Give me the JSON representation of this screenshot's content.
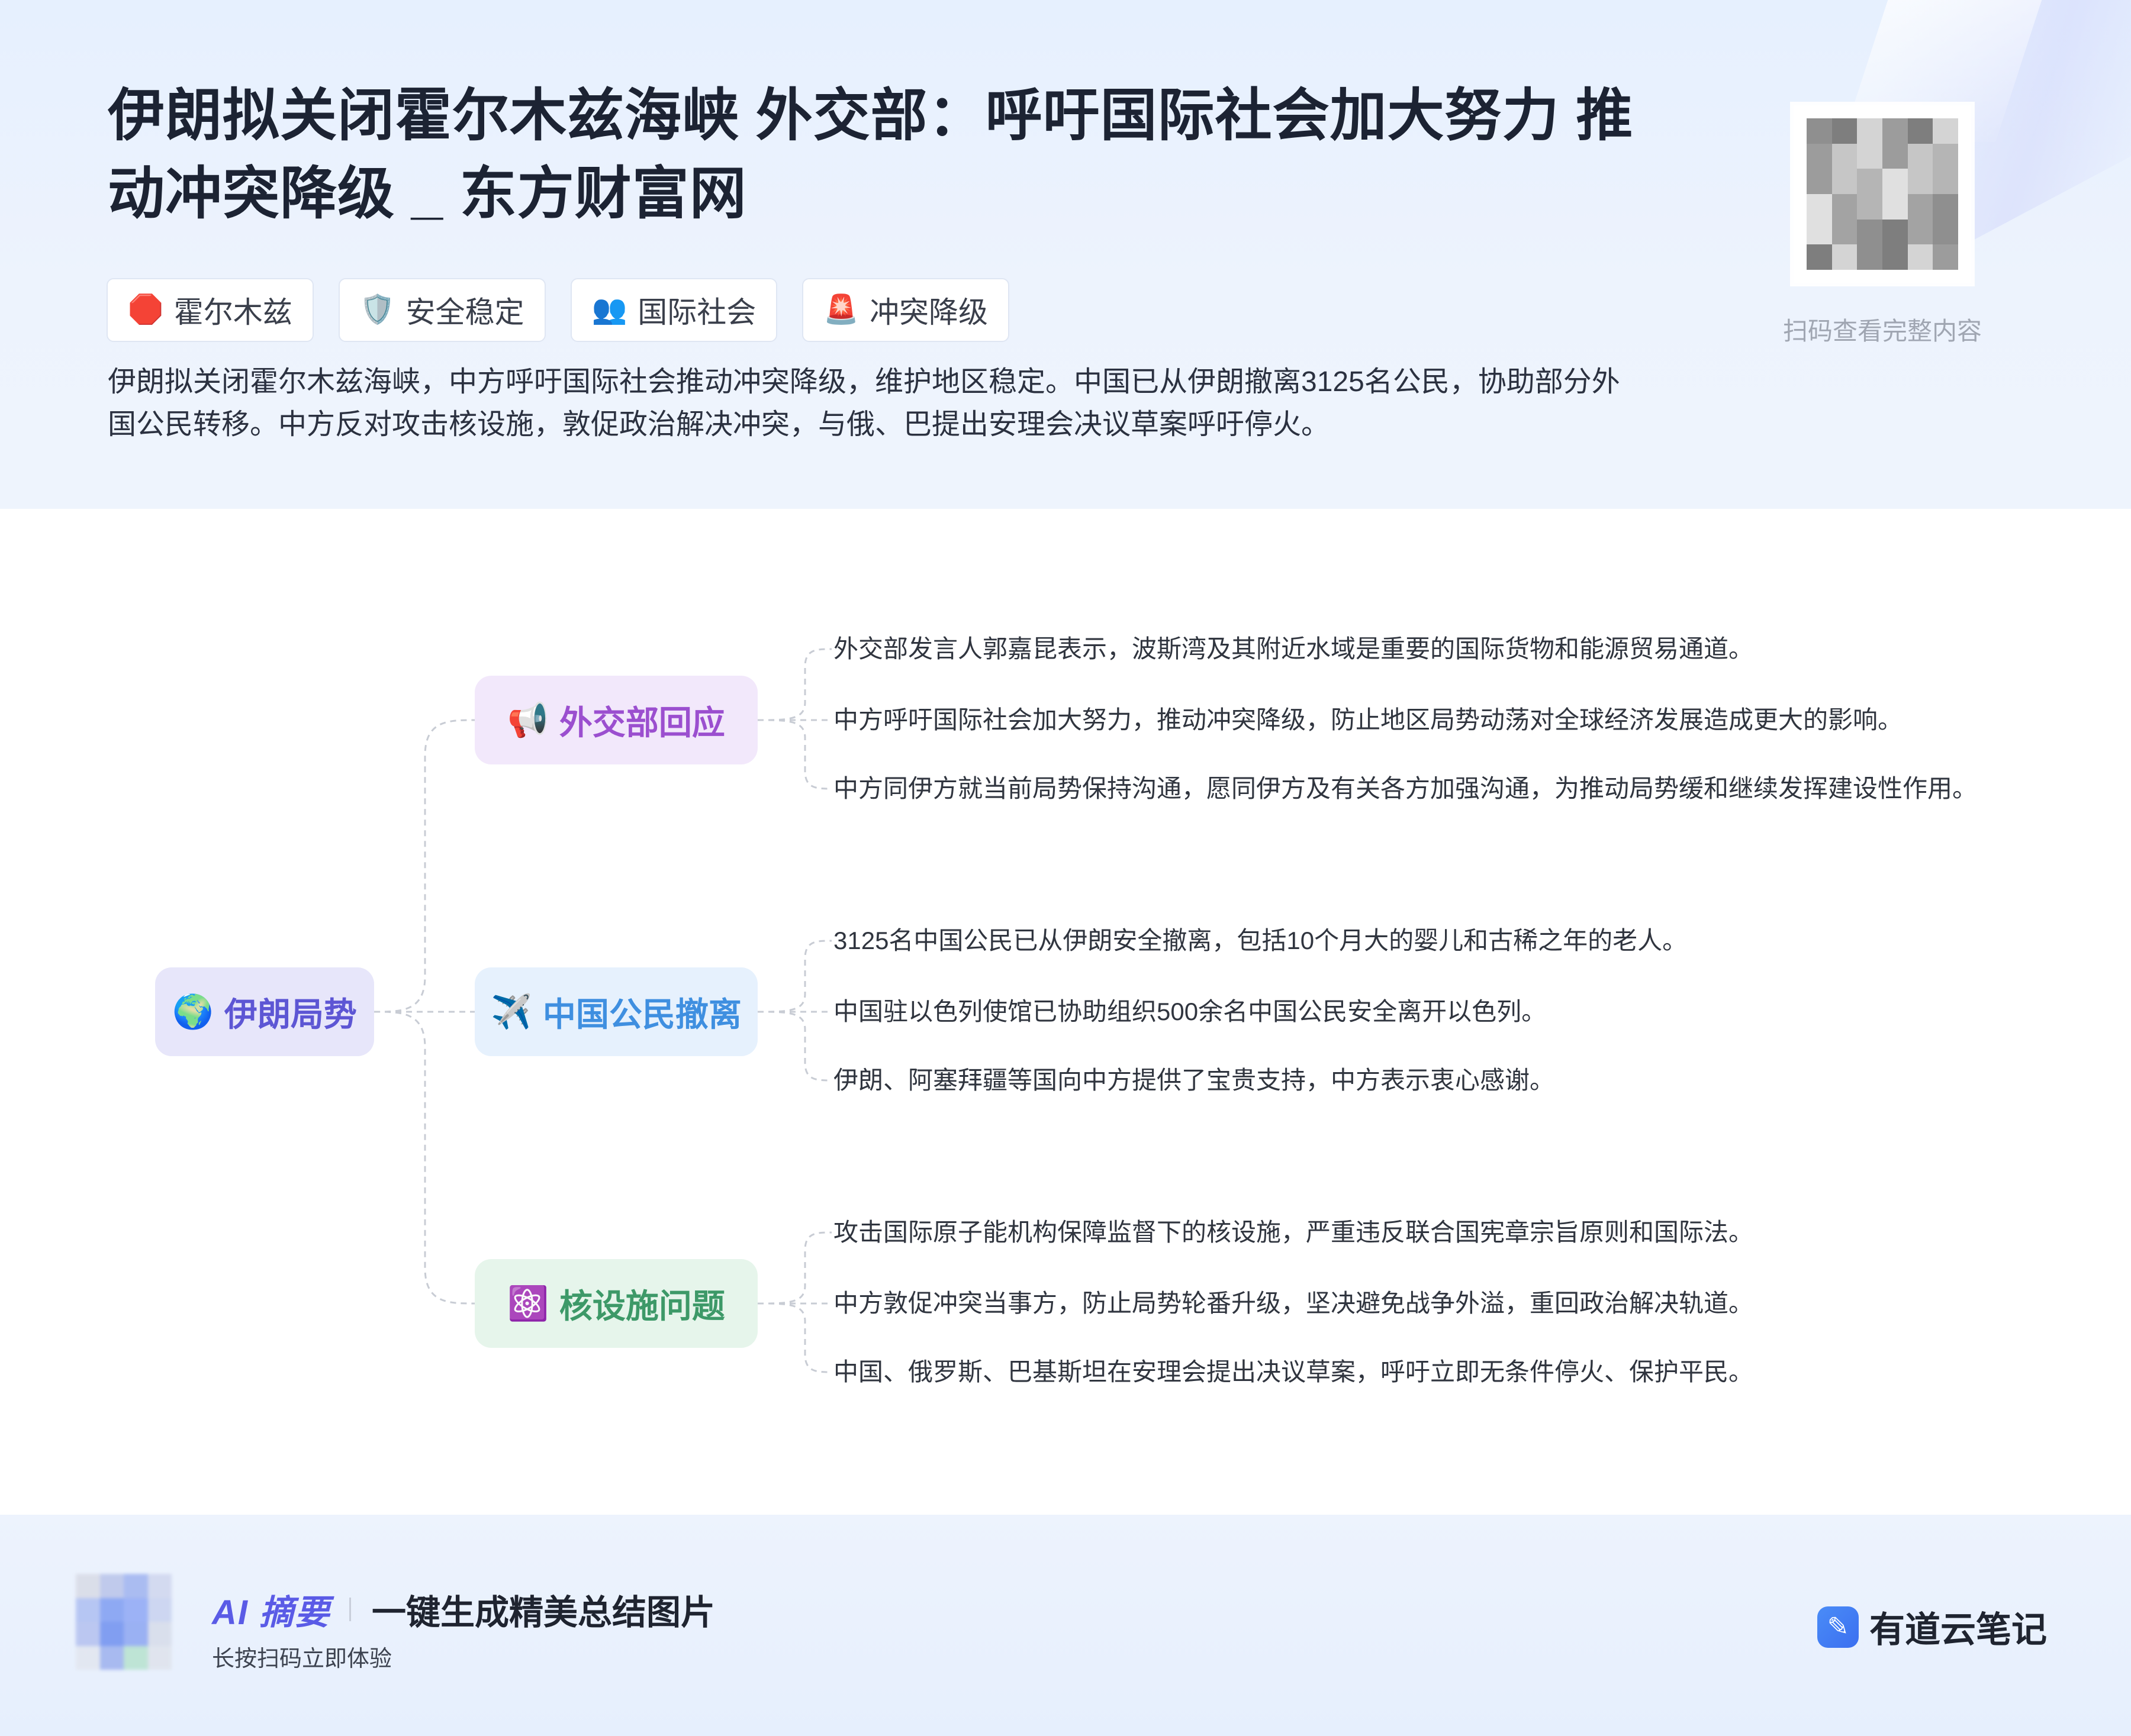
{
  "header": {
    "title": "伊朗拟关闭霍尔木兹海峡 外交部：呼吁国际社会加大努力 推动冲突降级 _ 东方财富网",
    "tags": [
      {
        "icon": "🛑",
        "label": "霍尔木兹"
      },
      {
        "icon": "🛡️",
        "label": "安全稳定"
      },
      {
        "icon": "👥",
        "label": "国际社会"
      },
      {
        "icon": "🚨",
        "label": "冲突降级"
      }
    ],
    "summary": "伊朗拟关闭霍尔木兹海峡，中方呼吁国际社会推动冲突降级，维护地区稳定。中国已从伊朗撤离3125名公民，协助部分外国公民转移。中方反对攻击核设施，敦促政治解决冲突，与俄、巴提出安理会决议草案呼吁停火。",
    "qr_caption": "扫码查看完整内容"
  },
  "mindmap": {
    "root": {
      "icon": "🌍",
      "label": "伊朗局势"
    },
    "branches": [
      {
        "icon": "📢",
        "label": "外交部回应",
        "leaves": [
          "外交部发言人郭嘉昆表示，波斯湾及其附近水域是重要的国际货物和能源贸易通道。",
          "中方呼吁国际社会加大努力，推动冲突降级，防止地区局势动荡对全球经济发展造成更大的影响。",
          "中方同伊方就当前局势保持沟通，愿同伊方及有关各方加强沟通，为推动局势缓和继续发挥建设性作用。"
        ]
      },
      {
        "icon": "✈️",
        "label": "中国公民撤离",
        "leaves": [
          "3125名中国公民已从伊朗安全撤离，包括10个月大的婴儿和古稀之年的老人。",
          "中国驻以色列使馆已协助组织500余名中国公民安全离开以色列。",
          "伊朗、阿塞拜疆等国向中方提供了宝贵支持，中方表示衷心感谢。"
        ]
      },
      {
        "icon": "⚛️",
        "label": "核设施问题",
        "leaves": [
          "攻击国际原子能机构保障监督下的核设施，严重违反联合国宪章宗旨原则和国际法。",
          "中方敦促冲突当事方，防止局势轮番升级，坚决避免战争外溢，重回政治解决轨道。",
          "中国、俄罗斯、巴基斯坦在安理会提出决议草案，呼吁立即无条件停火、保护平民。"
        ]
      }
    ]
  },
  "footer": {
    "ai_label": "AI 摘要",
    "ai_tagline": "一键生成精美总结图片",
    "ai_sub": "长按扫码立即体验",
    "brand": "有道云笔记"
  },
  "colors": {
    "root": "#5d56d4",
    "branch1": "#9b4fcf",
    "branch2": "#3f8fe0",
    "branch3": "#3d9968",
    "connector": "#c8ccd4"
  }
}
